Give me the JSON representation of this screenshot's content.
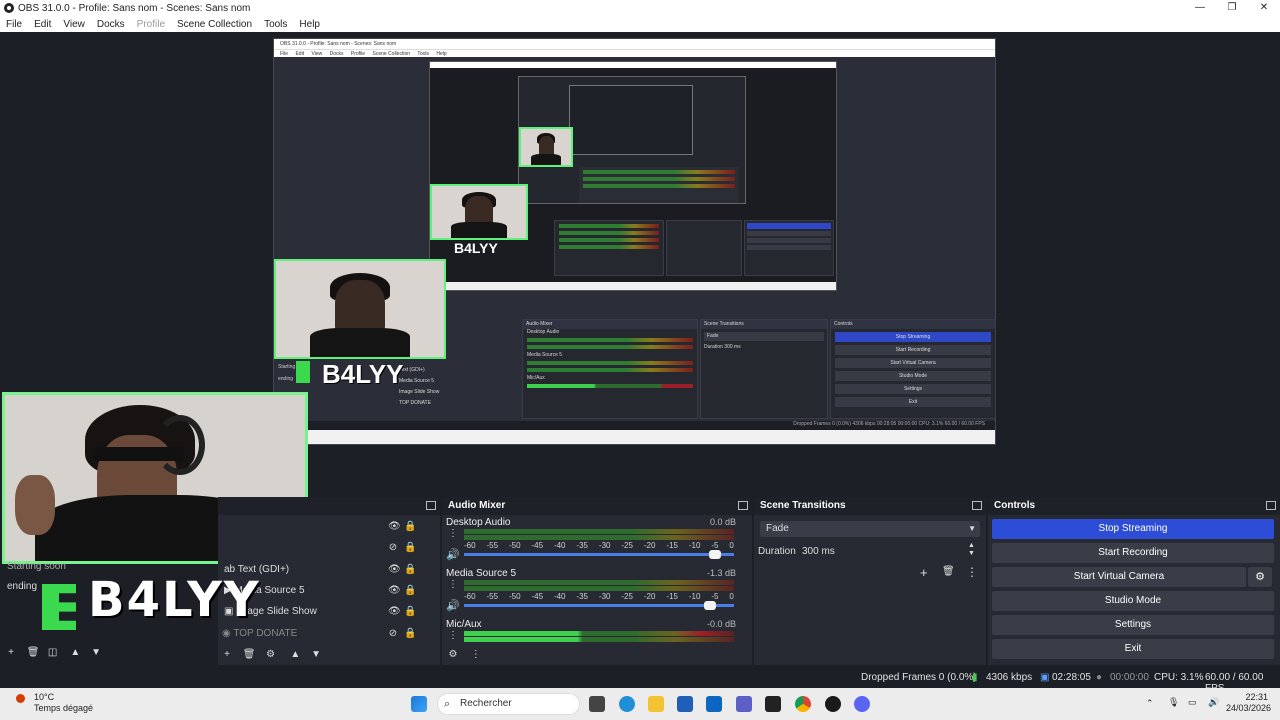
{
  "window": {
    "title": "OBS 31.0.0 - Profile: Sans nom - Scenes: Sans nom",
    "controls": [
      "—",
      "❐",
      "✕"
    ]
  },
  "menu": [
    "File",
    "Edit",
    "View",
    "Docks",
    "Profile",
    "Scene Collection",
    "Tools",
    "Help"
  ],
  "overlay": {
    "brand_text": "B4LYY"
  },
  "nested_preview": {
    "title": "OBS 31.0.0 - Profile: Sans nom - Scenes: Sans nom",
    "menu": [
      "File",
      "Edit",
      "View",
      "Docks",
      "Profile",
      "Scene Collection",
      "Tools",
      "Help"
    ],
    "audio_mixer": "Audio Mixer",
    "scene_transitions": "Scene Transitions",
    "controls": "Controls",
    "transition": "Fade",
    "duration_label": "Duration",
    "duration_value": "300 ms",
    "buttons": [
      "Stop Streaming",
      "Start Recording",
      "Start Virtual Camera",
      "Studio Mode",
      "Settings",
      "Exit"
    ],
    "sources": [
      "Text (GDI+)",
      "Media Source 5",
      "Image Slide Show",
      "TOP DONATE"
    ],
    "mixer_channels": [
      "Desktop Audio",
      "Media Source 5",
      "Mic/Aux"
    ],
    "status": "Dropped Frames 0 (0.0%)   4306 kbps   00:28:05   00:00:00   CPU: 3.1%   60.00 / 60.00 FPS",
    "scene_labels": [
      "Starting soon",
      "ending"
    ]
  },
  "scenes_dock": {
    "items": [
      "Starting soon",
      "ending"
    ]
  },
  "sources_dock": {
    "items": [
      {
        "name": "Text (GDI+)",
        "icon": "ab"
      },
      {
        "name": "Media Source 5",
        "icon": "▶"
      },
      {
        "name": "Image Slide Show",
        "icon": "▣"
      },
      {
        "name": "TOP DONATE",
        "icon": "◉"
      }
    ]
  },
  "audio_mixer": {
    "title": "Audio Mixer",
    "channels": [
      {
        "name": "Desktop Audio",
        "db": "0.0 dB",
        "volume_fraction": 0.93
      },
      {
        "name": "Media Source 5",
        "db": "-1.3 dB",
        "volume_fraction": 0.91
      },
      {
        "name": "Mic/Aux",
        "db": "-0.0 dB",
        "volume_fraction": 0.93
      }
    ],
    "ticks": [
      "-60",
      "-55",
      "-50",
      "-45",
      "-40",
      "-35",
      "-30",
      "-25",
      "-20",
      "-15",
      "-10",
      "-5",
      "0"
    ]
  },
  "scene_transitions": {
    "title": "Scene Transitions",
    "transition": "Fade",
    "duration_label": "Duration",
    "duration_value": "300 ms"
  },
  "controls": {
    "title": "Controls",
    "stop_streaming": "Stop Streaming",
    "start_recording": "Start Recording",
    "start_virtual_camera": "Start Virtual Camera",
    "studio_mode": "Studio Mode",
    "settings": "Settings",
    "exit": "Exit"
  },
  "status": {
    "dropped_frames": "Dropped Frames 0 (0.0%)",
    "bitrate": "4306 kbps",
    "stream_time": "02:28:05",
    "record_time": "00:00:00",
    "cpu": "CPU: 3.1%",
    "fps": "60.00 / 60.00 FPS"
  },
  "taskbar": {
    "temperature": "10°C",
    "weather": "Temps dégagé",
    "search_placeholder": "Rechercher",
    "time": "22:31",
    "date": "24/03/2026"
  },
  "colors": {
    "accent_blue": "#2d4dd6",
    "meter_green": "#2e6b2f",
    "webcam_border": "#78f28c",
    "brand_green": "#3ad94e"
  }
}
